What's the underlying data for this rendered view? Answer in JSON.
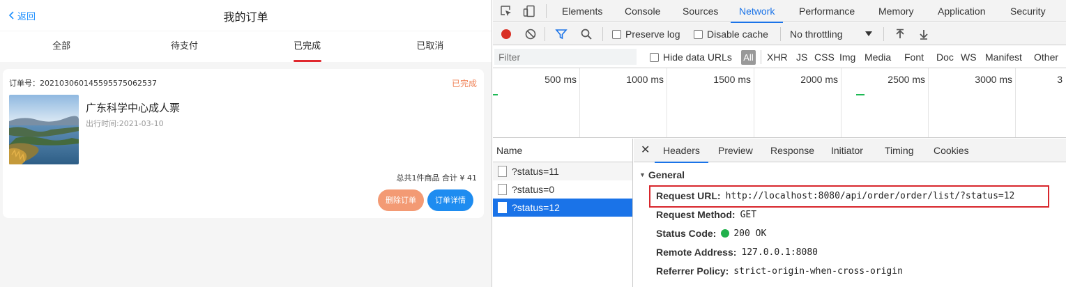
{
  "mobile": {
    "back_label": "返回",
    "title": "我的订单",
    "tabs": [
      "全部",
      "待支付",
      "已完成",
      "已取消"
    ],
    "active_tab": "已完成",
    "order": {
      "order_no": "订单号：20210306014559557506253​7",
      "status": "已完成",
      "product_name": "广东科学中心成人票",
      "travel_date": "出行时间:2021-03-10",
      "total": "总共1件商品 合计 ¥ 41",
      "delete_label": "删除订单",
      "detail_label": "订单详情"
    }
  },
  "devtools": {
    "tabs": [
      "Elements",
      "Console",
      "Sources",
      "Network",
      "Performance",
      "Memory",
      "Application",
      "Security"
    ],
    "active_tab": "Network",
    "toolbar": {
      "preserve_log": "Preserve log",
      "disable_cache": "Disable cache",
      "throttling": "No throttling"
    },
    "filter": {
      "placeholder": "Filter",
      "hide_data_urls": "Hide data URLs",
      "all": "All",
      "types": [
        "XHR",
        "JS",
        "CSS",
        "Img",
        "Media",
        "Font",
        "Doc",
        "WS",
        "Manifest",
        "Other"
      ]
    },
    "timeline_labels": [
      "500 ms",
      "1000 ms",
      "1500 ms",
      "2000 ms",
      "2500 ms",
      "3000 ms",
      "3"
    ],
    "name_header": "Name",
    "requests": [
      "?status=11",
      "?status=0",
      "?status=12"
    ],
    "selected_request": "?status=12",
    "detail_tabs": [
      "Headers",
      "Preview",
      "Response",
      "Initiator",
      "Timing",
      "Cookies"
    ],
    "active_detail_tab": "Headers",
    "general": {
      "heading": "General",
      "request_url_label": "Request URL:",
      "request_url": "http://localhost:8080/api/order/order/list/?status=12",
      "request_method_label": "Request Method:",
      "request_method": "GET",
      "status_code_label": "Status Code:",
      "status_code": "200 OK",
      "remote_address_label": "Remote Address:",
      "remote_address": "127.0.0.1:8080",
      "referrer_policy_label": "Referrer Policy:",
      "referrer_policy": "strict-origin-when-cross-origin"
    }
  }
}
